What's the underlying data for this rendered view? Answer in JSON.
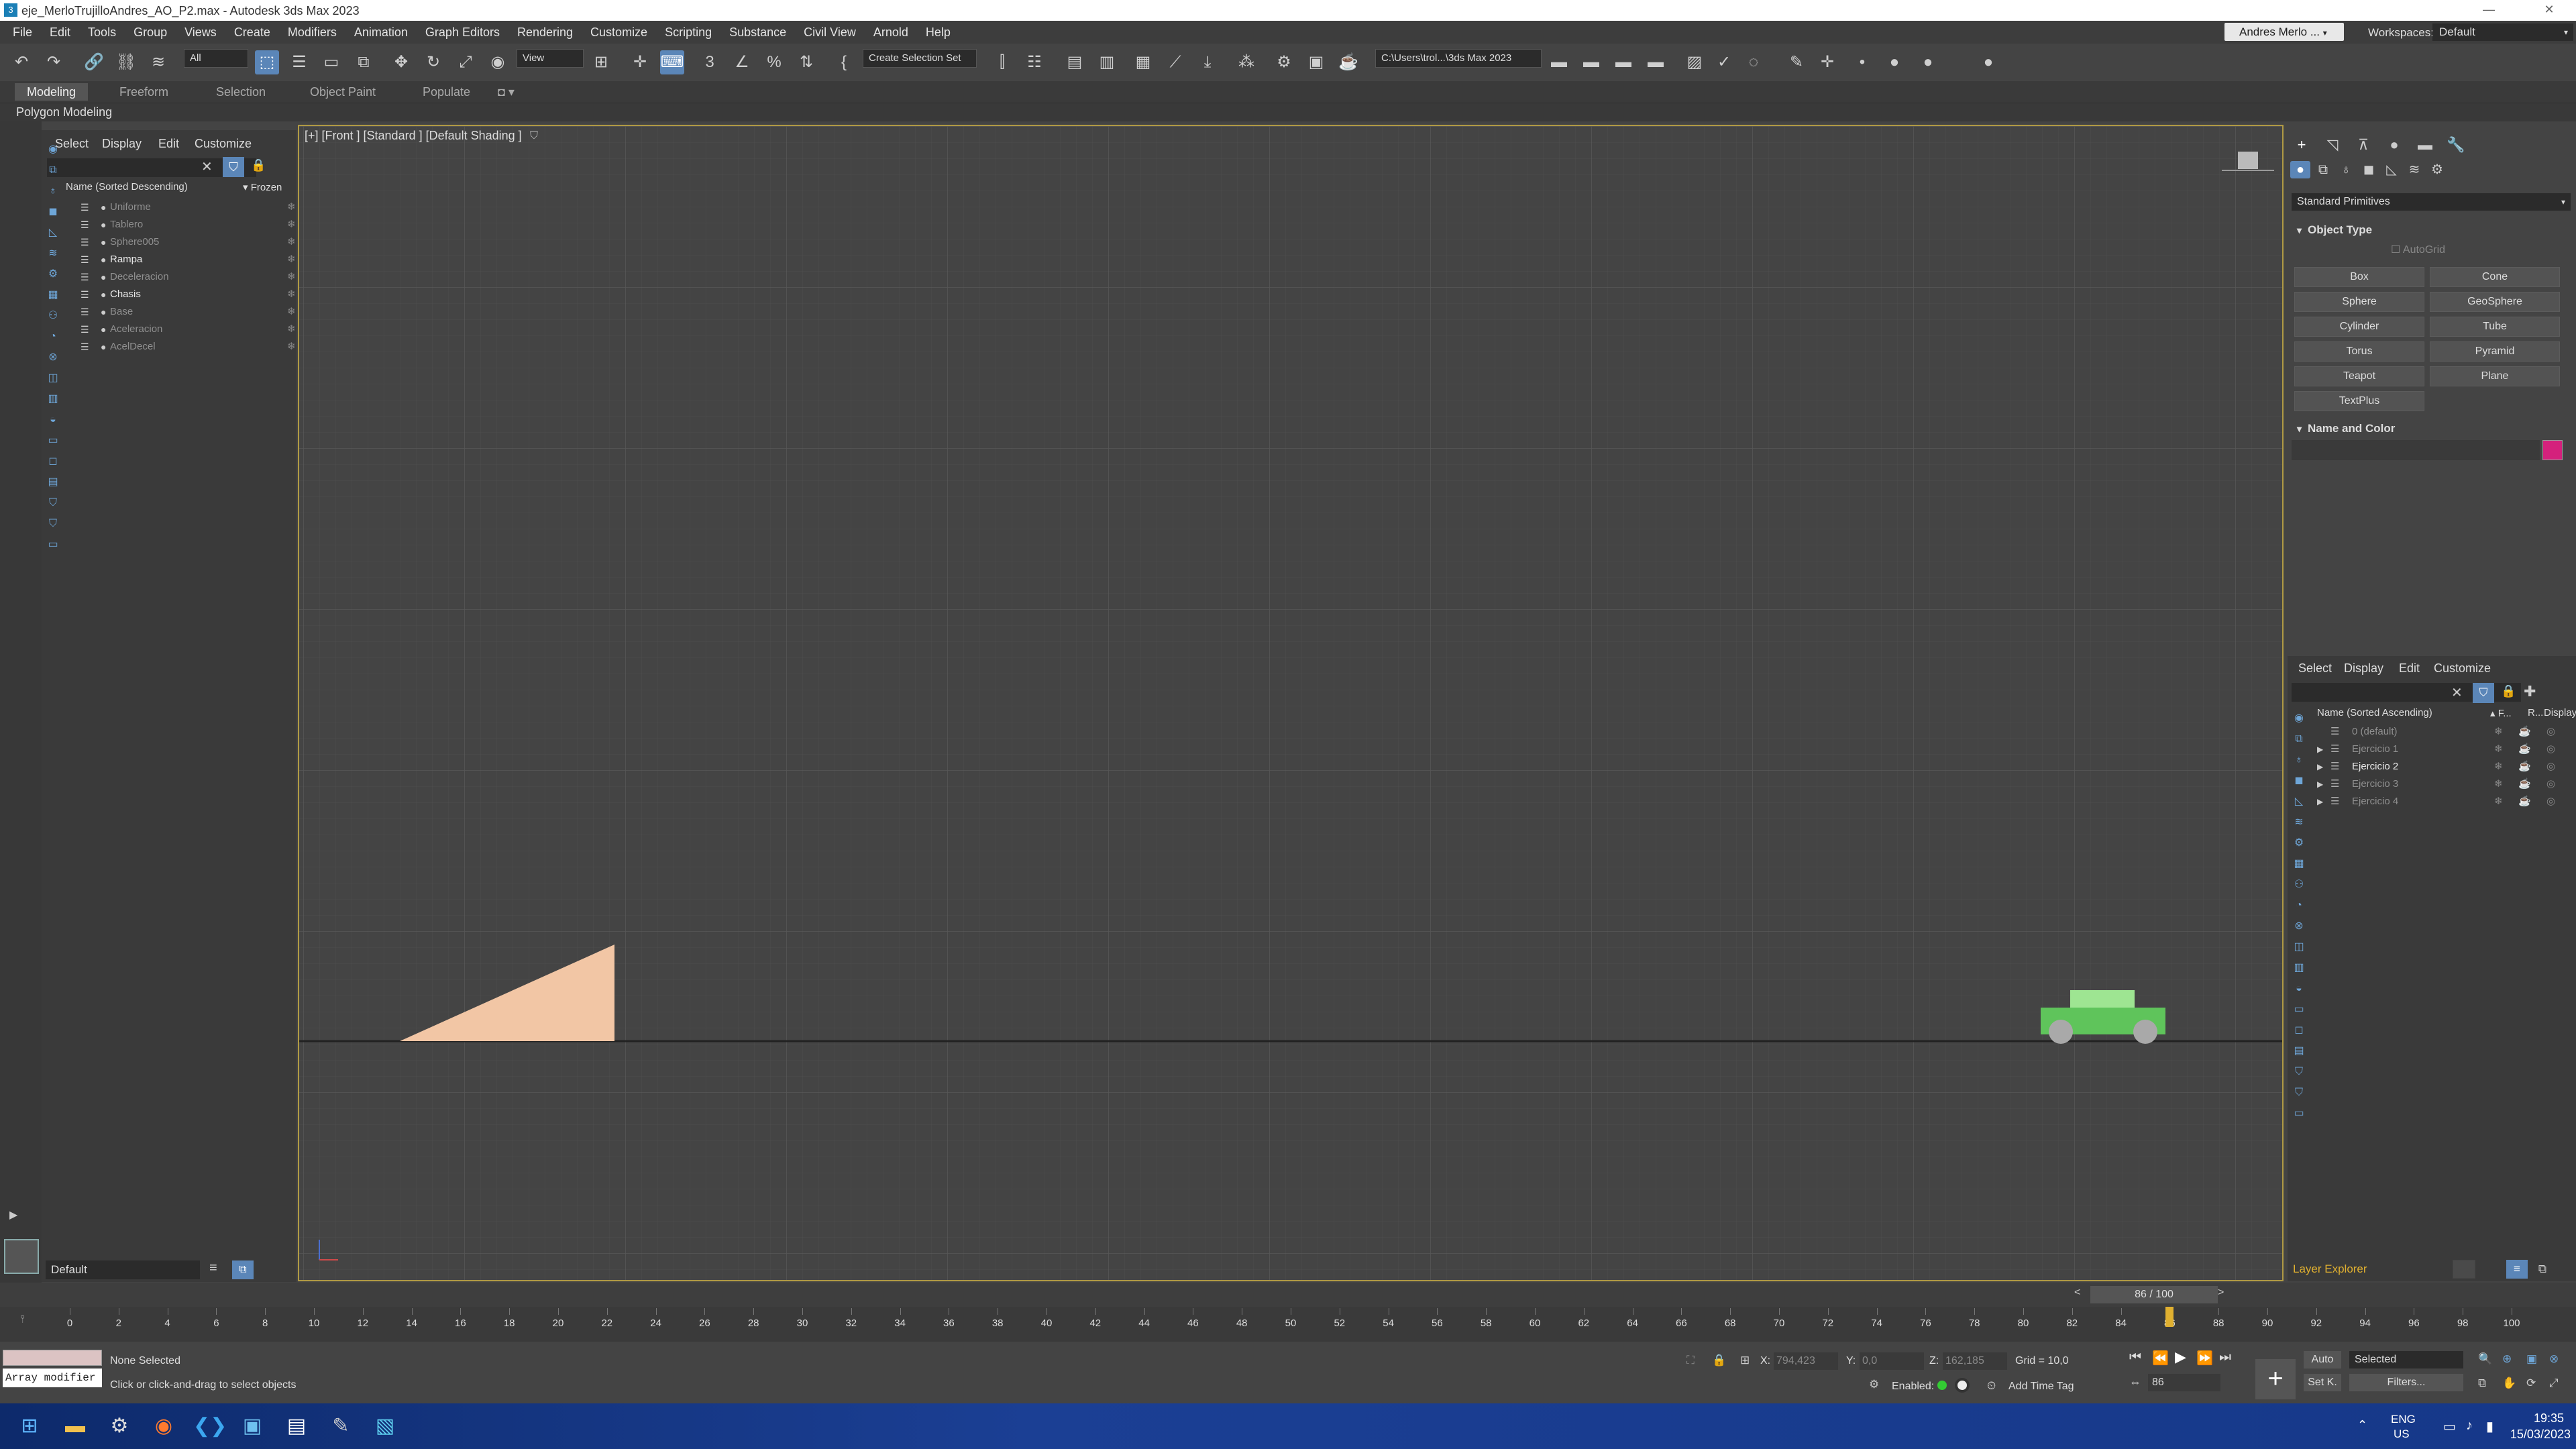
{
  "app": {
    "title": "eje_MerloTrujilloAndres_AO_P2.max - Autodesk 3ds Max 2023",
    "logo": "3"
  },
  "menubar": {
    "items": [
      "File",
      "Edit",
      "Tools",
      "Group",
      "Views",
      "Create",
      "Modifiers",
      "Animation",
      "Graph Editors",
      "Rendering",
      "Customize",
      "Scripting",
      "Substance",
      "Civil View",
      "Arnold",
      "Help"
    ],
    "user": "Andres Merlo ...",
    "workspaces_label": "Workspaces:",
    "workspace": "Default"
  },
  "toolbar": {
    "selection_filter": "All",
    "ref_coord": "View",
    "named_selection": "Create Selection Set",
    "project_path": "C:\\Users\\trol...\\3ds Max 2023"
  },
  "ribbon": {
    "tabs": [
      "Modeling",
      "Freeform",
      "Selection",
      "Object Paint",
      "Populate"
    ],
    "subtitle": "Polygon Modeling"
  },
  "scene_explorer": {
    "menu": [
      "Select",
      "Display",
      "Edit",
      "Customize"
    ],
    "col_name": "Name (Sorted Descending)",
    "col_frozen": "Frozen",
    "rows": [
      {
        "name": "Uniforme",
        "style": "dim"
      },
      {
        "name": "Tablero",
        "style": "dim"
      },
      {
        "name": "Sphere005",
        "style": "dim"
      },
      {
        "name": "Rampa",
        "style": "bright"
      },
      {
        "name": "Deceleracion",
        "style": "dim"
      },
      {
        "name": "Chasis",
        "style": "bright"
      },
      {
        "name": "Base",
        "style": "dim"
      },
      {
        "name": "Aceleracion",
        "style": "dim"
      },
      {
        "name": "AcelDecel",
        "style": "dim"
      }
    ],
    "layer": "Default"
  },
  "viewport": {
    "label": "[+] [Front ] [Standard ] [Default Shading ]",
    "ramp_color": "#f2c6a5",
    "car_body_color": "#5fc45b",
    "car_top_color": "#9ee592"
  },
  "command_panel": {
    "category": "Standard Primitives",
    "rollout_object_type": "Object Type",
    "autogrid": "AutoGrid",
    "buttons": [
      "Box",
      "Cone",
      "Sphere",
      "GeoSphere",
      "Cylinder",
      "Tube",
      "Torus",
      "Pyramid",
      "Teapot",
      "Plane",
      "TextPlus"
    ],
    "rollout_name_color": "Name and Color",
    "color": "#d4217c"
  },
  "layer_explorer": {
    "menu": [
      "Select",
      "Display",
      "Edit",
      "Customize"
    ],
    "col_name": "Name (Sorted Ascending)",
    "col_f": "▴ F...",
    "col_r": "R...",
    "col_display": "Display...",
    "rows": [
      {
        "name": "0 (default)",
        "style": "dim",
        "arrow": ""
      },
      {
        "name": "Ejercicio 1",
        "style": "dim",
        "arrow": "▶"
      },
      {
        "name": "Ejercicio 2",
        "style": "bright",
        "arrow": "▶"
      },
      {
        "name": "Ejercicio 3",
        "style": "dim",
        "arrow": "▶"
      },
      {
        "name": "Ejercicio 4",
        "style": "dim",
        "arrow": "▶"
      }
    ],
    "footer": "Layer Explorer"
  },
  "timeline": {
    "frame": "86 / 100",
    "ticks": [
      "0",
      "2",
      "4",
      "6",
      "8",
      "10",
      "12",
      "14",
      "16",
      "18",
      "20",
      "22",
      "24",
      "26",
      "28",
      "30",
      "32",
      "34",
      "36",
      "38",
      "40",
      "42",
      "44",
      "46",
      "48",
      "50",
      "52",
      "54",
      "56",
      "58",
      "60",
      "62",
      "64",
      "66",
      "68",
      "70",
      "72",
      "74",
      "76",
      "78",
      "80",
      "82",
      "84",
      "86",
      "88",
      "90",
      "92",
      "94",
      "96",
      "98",
      "100"
    ],
    "current": 86,
    "total": 100
  },
  "status": {
    "selection": "None Selected",
    "prompt": "Click or click-and-drag to select objects",
    "maxscript": "Array modifier",
    "x_label": "X:",
    "x_val": "794,423",
    "y_label": "Y:",
    "y_val": "0,0",
    "z_label": "Z:",
    "z_val": "162,185",
    "grid": "Grid = 10,0",
    "enabled": "Enabled:",
    "add_time_tag": "Add Time Tag",
    "auto": "Auto",
    "selected": "Selected",
    "setk": "Set K.",
    "filters": "Filters...",
    "frame_field": "86"
  },
  "taskbar": {
    "lang1": "ENG",
    "lang2": "US",
    "time": "19:35",
    "date": "15/03/2023"
  }
}
